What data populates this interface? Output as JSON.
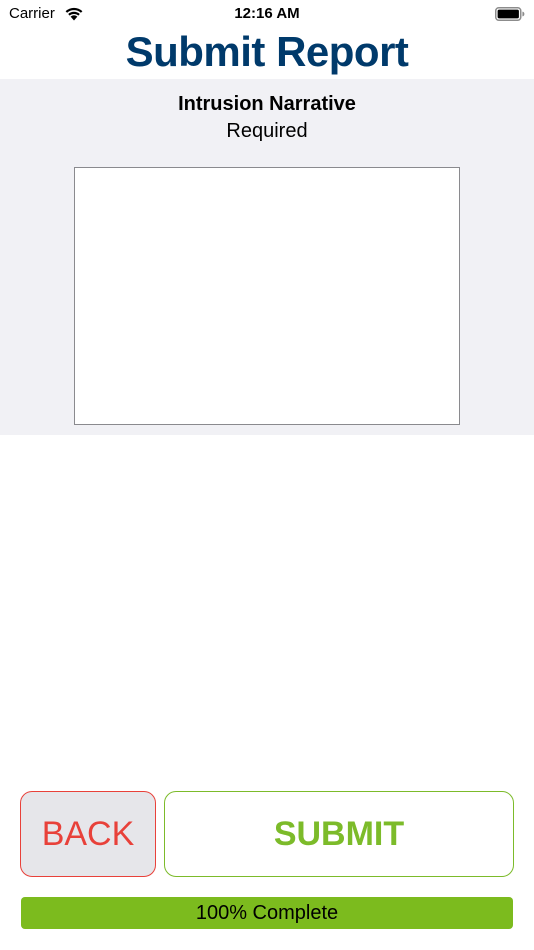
{
  "status_bar": {
    "carrier": "Carrier",
    "time": "12:16 AM",
    "wifi_icon": "wifi-icon",
    "battery_icon": "battery-full-icon"
  },
  "header": {
    "title": "Submit Report",
    "title_color": "#003a6b"
  },
  "form": {
    "field_title": "Intrusion Narrative",
    "field_requirement": "Required",
    "narrative_value": "",
    "section_background": "#f1f1f5"
  },
  "actions": {
    "back_label": "BACK",
    "back_color": "#e8413a",
    "submit_label": "SUBMIT",
    "submit_color": "#7cbb2a"
  },
  "progress": {
    "percent": 100,
    "label": "100% Complete",
    "fill_color": "#7cbb1e"
  }
}
